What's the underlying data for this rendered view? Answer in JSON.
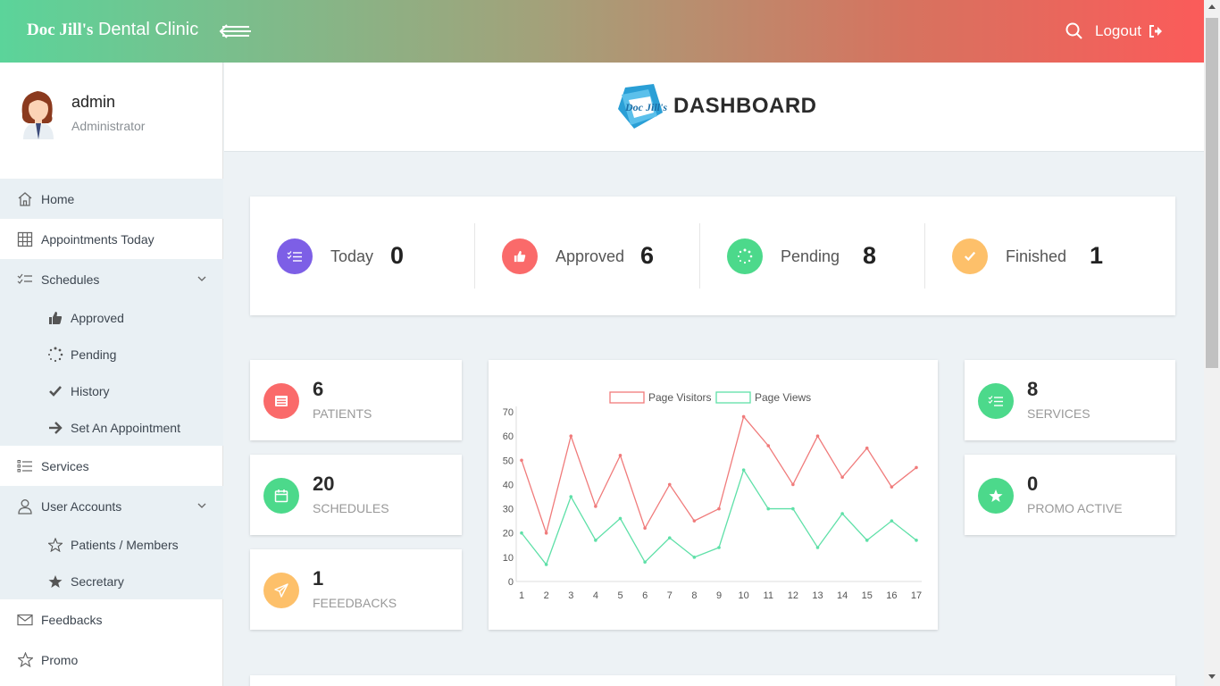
{
  "topbar": {
    "brand_part1": "Doc Jill's",
    "brand_part2": "Dental Clinic",
    "logout_label": "Logout",
    "icons": [
      "menu-arrow-icon",
      "search-icon",
      "logout-icon"
    ]
  },
  "profile": {
    "name": "admin",
    "role": "Administrator"
  },
  "sidebar": {
    "home": "Home",
    "appointments_today": "Appointments Today",
    "schedules": "Schedules",
    "schedules_sub": {
      "approved": "Approved",
      "pending": "Pending",
      "history": "History",
      "set_appointment": "Set An Appointment"
    },
    "services": "Services",
    "user_accounts": "User Accounts",
    "user_accounts_sub": {
      "patients": "Patients / Members",
      "secretary": "Secretary"
    },
    "feedbacks": "Feedbacks",
    "promo": "Promo"
  },
  "header": {
    "logo_text": "Doc Jill's",
    "title": "DASHBOARD"
  },
  "stats": {
    "today": {
      "label": "Today",
      "value": "0",
      "color": "#7d5fe6"
    },
    "approved": {
      "label": "Approved",
      "value": "6",
      "color": "#fa6a6a"
    },
    "pending": {
      "label": "Pending",
      "value": "8",
      "color": "#4cd98b"
    },
    "finished": {
      "label": "Finished",
      "value": "1",
      "color": "#fdc06a"
    }
  },
  "cards": {
    "patients": {
      "value": "6",
      "label": "PATIENTS",
      "color": "#fa6a6a"
    },
    "schedules": {
      "value": "20",
      "label": "SCHEDULES",
      "color": "#4cd98b"
    },
    "feedbacks": {
      "value": "1",
      "label": "FEEEDBACKS",
      "color": "#fdc06a"
    },
    "services": {
      "value": "8",
      "label": "SERVICES",
      "color": "#4cd98b"
    },
    "promo": {
      "value": "0",
      "label": "PROMO ACTIVE",
      "color": "#4cd98b"
    }
  },
  "chart_data": {
    "type": "line",
    "x": [
      1,
      2,
      3,
      4,
      5,
      6,
      7,
      8,
      9,
      10,
      11,
      12,
      13,
      14,
      15,
      16,
      17
    ],
    "series": [
      {
        "name": "Page Visitors",
        "color": "#f07b7b",
        "values": [
          50,
          20,
          60,
          31,
          52,
          22,
          40,
          25,
          30,
          68,
          56,
          40,
          60,
          43,
          55,
          39,
          47
        ]
      },
      {
        "name": "Page Views",
        "color": "#5fe0a8",
        "values": [
          20,
          7,
          35,
          17,
          26,
          8,
          18,
          10,
          14,
          46,
          30,
          30,
          14,
          28,
          17,
          25,
          17
        ]
      }
    ],
    "ylim": [
      0,
      70
    ],
    "yticks": [
      0,
      10,
      20,
      30,
      40,
      50,
      60,
      70
    ],
    "legend": "top"
  }
}
